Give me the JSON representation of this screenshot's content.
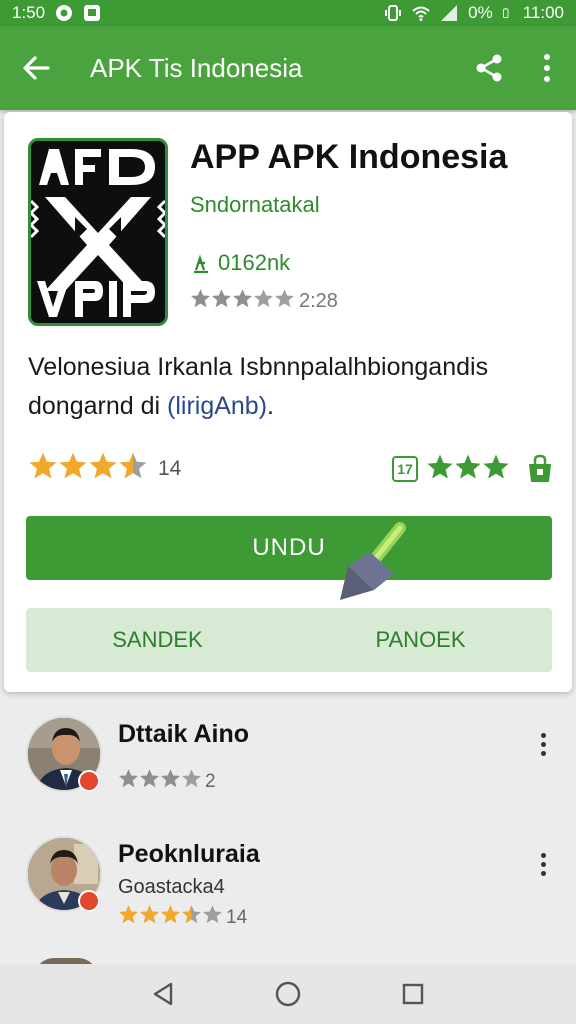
{
  "status_bar": {
    "time_left": "1:50",
    "battery": "0%",
    "time_right": "11:00"
  },
  "app_bar": {
    "title": "APK Tis Indonesia",
    "icons": [
      "back-arrow-icon",
      "share-icon",
      "overflow-menu-icon"
    ]
  },
  "app": {
    "name": "APP APK Indonesia",
    "developer": "Sndornatakal",
    "downloads": "0162nk",
    "mini_rating_value": "2:28",
    "mini_rating_stars": 3,
    "description_main": "Velonesiua Irkanla Isbnnpalalhbiongandis dongarnd di",
    "description_link": "(lirigAnb)",
    "description_end": ".",
    "rating_stars": 3.5,
    "rating_count": "14",
    "badge": "17",
    "right_stars": 3
  },
  "buttons": {
    "install": "UNDU",
    "secondary_left": "SANDEK",
    "secondary_right": "PANOEK"
  },
  "reviews": [
    {
      "name": "Dttaik Aino",
      "sub": "",
      "stars": 3,
      "count": "2"
    },
    {
      "name": "Peoknluraia",
      "sub": "Goastacka4",
      "stars": 3.5,
      "count": "14"
    }
  ],
  "colors": {
    "primary_green": "#4aa33e",
    "dark_green": "#3d9a35",
    "star_gold": "#f2a92b",
    "star_grey": "#9e9e9e",
    "light_green": "#d7ebd4"
  }
}
